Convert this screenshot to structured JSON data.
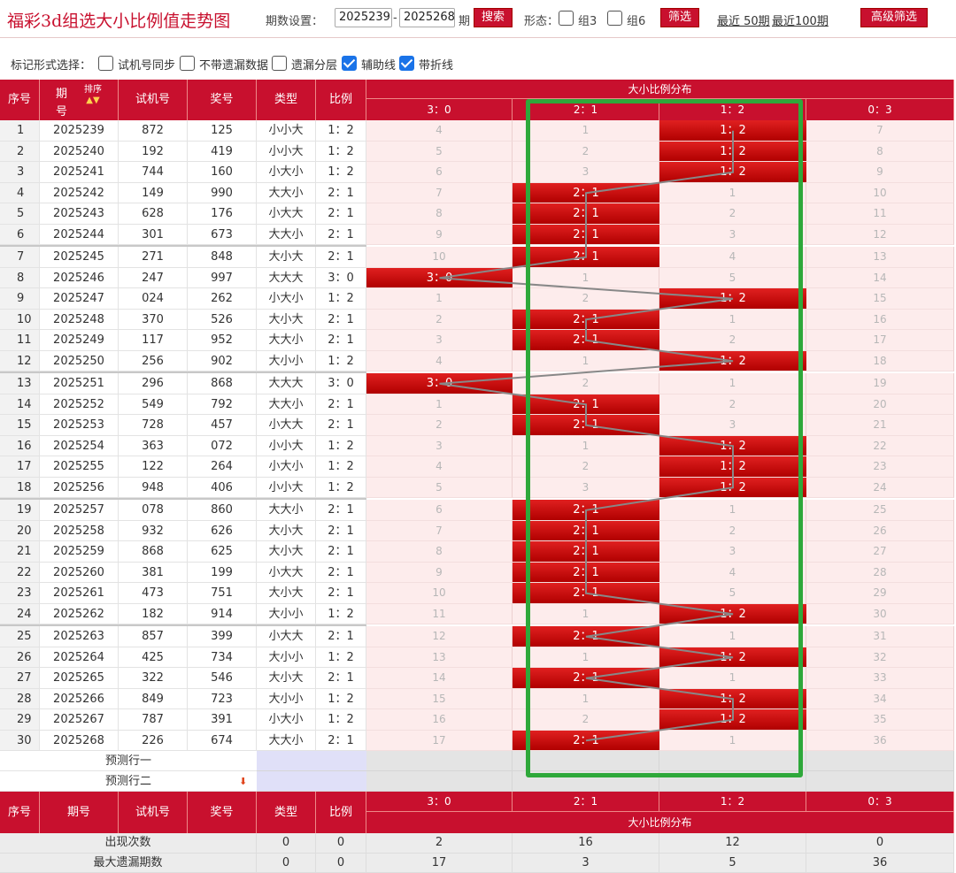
{
  "header": {
    "title": "福彩3d组选大小比例值走势图",
    "period_setting_label": "期数设置：",
    "period_start": "2025239",
    "period_dash": "-",
    "period_end": "2025268",
    "period_unit": "期",
    "search_button": "搜索",
    "form_label": "形态：",
    "group3_label": "组3",
    "group6_label": "组6",
    "filter_button": "筛选",
    "recent50_link": "最近 50期",
    "recent100_link": "最近100期",
    "advanced_button": "高级筛选"
  },
  "mark_options": {
    "label": "标记形式选择：",
    "items": [
      {
        "label": "试机号同步",
        "checked": false
      },
      {
        "label": "不带遗漏数据",
        "checked": false
      },
      {
        "label": "遗漏分层",
        "checked": false
      },
      {
        "label": "辅助线",
        "checked": true
      },
      {
        "label": "带折线",
        "checked": true
      }
    ]
  },
  "table": {
    "headers": {
      "seq": "序号",
      "issue_top": "期",
      "issue_bottom": "号",
      "sort_label": "排序",
      "trial": "试机号",
      "prize": "奖号",
      "type": "类型",
      "ratio": "比例",
      "distribution": "大小比例分布",
      "issue": "期号"
    },
    "ratio_columns": [
      "3：0",
      "2：1",
      "1：2",
      "0：3"
    ],
    "rows": [
      {
        "seq": "1",
        "issue": "2025239",
        "trial": "872",
        "prize": "125",
        "type": "小小大",
        "ratio": "1：2",
        "dist": [
          "4",
          "1",
          "1：2",
          "7"
        ],
        "hit": 2
      },
      {
        "seq": "2",
        "issue": "2025240",
        "trial": "192",
        "prize": "419",
        "type": "小小大",
        "ratio": "1：2",
        "dist": [
          "5",
          "2",
          "1：2",
          "8"
        ],
        "hit": 2
      },
      {
        "seq": "3",
        "issue": "2025241",
        "trial": "744",
        "prize": "160",
        "type": "小大小",
        "ratio": "1：2",
        "dist": [
          "6",
          "3",
          "1：2",
          "9"
        ],
        "hit": 2
      },
      {
        "seq": "4",
        "issue": "2025242",
        "trial": "149",
        "prize": "990",
        "type": "大大小",
        "ratio": "2：1",
        "dist": [
          "7",
          "2：1",
          "1",
          "10"
        ],
        "hit": 1
      },
      {
        "seq": "5",
        "issue": "2025243",
        "trial": "628",
        "prize": "176",
        "type": "小大大",
        "ratio": "2：1",
        "dist": [
          "8",
          "2：1",
          "2",
          "11"
        ],
        "hit": 1
      },
      {
        "seq": "6",
        "issue": "2025244",
        "trial": "301",
        "prize": "673",
        "type": "大大小",
        "ratio": "2：1",
        "dist": [
          "9",
          "2：1",
          "3",
          "12"
        ],
        "hit": 1
      },
      {
        "seq": "7",
        "issue": "2025245",
        "trial": "271",
        "prize": "848",
        "type": "大小大",
        "ratio": "2：1",
        "dist": [
          "10",
          "2：1",
          "4",
          "13"
        ],
        "hit": 1
      },
      {
        "seq": "8",
        "issue": "2025246",
        "trial": "247",
        "prize": "997",
        "type": "大大大",
        "ratio": "3：0",
        "dist": [
          "3：0",
          "1",
          "5",
          "14"
        ],
        "hit": 0
      },
      {
        "seq": "9",
        "issue": "2025247",
        "trial": "024",
        "prize": "262",
        "type": "小大小",
        "ratio": "1：2",
        "dist": [
          "1",
          "2",
          "1：2",
          "15"
        ],
        "hit": 2
      },
      {
        "seq": "10",
        "issue": "2025248",
        "trial": "370",
        "prize": "526",
        "type": "大小大",
        "ratio": "2：1",
        "dist": [
          "2",
          "2：1",
          "1",
          "16"
        ],
        "hit": 1
      },
      {
        "seq": "11",
        "issue": "2025249",
        "trial": "117",
        "prize": "952",
        "type": "大大小",
        "ratio": "2：1",
        "dist": [
          "3",
          "2：1",
          "2",
          "17"
        ],
        "hit": 1
      },
      {
        "seq": "12",
        "issue": "2025250",
        "trial": "256",
        "prize": "902",
        "type": "大小小",
        "ratio": "1：2",
        "dist": [
          "4",
          "1",
          "1：2",
          "18"
        ],
        "hit": 2
      },
      {
        "seq": "13",
        "issue": "2025251",
        "trial": "296",
        "prize": "868",
        "type": "大大大",
        "ratio": "3：0",
        "dist": [
          "3：0",
          "2",
          "1",
          "19"
        ],
        "hit": 0
      },
      {
        "seq": "14",
        "issue": "2025252",
        "trial": "549",
        "prize": "792",
        "type": "大大小",
        "ratio": "2：1",
        "dist": [
          "1",
          "2：1",
          "2",
          "20"
        ],
        "hit": 1
      },
      {
        "seq": "15",
        "issue": "2025253",
        "trial": "728",
        "prize": "457",
        "type": "小大大",
        "ratio": "2：1",
        "dist": [
          "2",
          "2：1",
          "3",
          "21"
        ],
        "hit": 1
      },
      {
        "seq": "16",
        "issue": "2025254",
        "trial": "363",
        "prize": "072",
        "type": "小小大",
        "ratio": "1：2",
        "dist": [
          "3",
          "1",
          "1：2",
          "22"
        ],
        "hit": 2
      },
      {
        "seq": "17",
        "issue": "2025255",
        "trial": "122",
        "prize": "264",
        "type": "小大小",
        "ratio": "1：2",
        "dist": [
          "4",
          "2",
          "1：2",
          "23"
        ],
        "hit": 2
      },
      {
        "seq": "18",
        "issue": "2025256",
        "trial": "948",
        "prize": "406",
        "type": "小小大",
        "ratio": "1：2",
        "dist": [
          "5",
          "3",
          "1：2",
          "24"
        ],
        "hit": 2
      },
      {
        "seq": "19",
        "issue": "2025257",
        "trial": "078",
        "prize": "860",
        "type": "大大小",
        "ratio": "2：1",
        "dist": [
          "6",
          "2：1",
          "1",
          "25"
        ],
        "hit": 1
      },
      {
        "seq": "20",
        "issue": "2025258",
        "trial": "932",
        "prize": "626",
        "type": "大小大",
        "ratio": "2：1",
        "dist": [
          "7",
          "2：1",
          "2",
          "26"
        ],
        "hit": 1
      },
      {
        "seq": "21",
        "issue": "2025259",
        "trial": "868",
        "prize": "625",
        "type": "大小大",
        "ratio": "2：1",
        "dist": [
          "8",
          "2：1",
          "3",
          "27"
        ],
        "hit": 1
      },
      {
        "seq": "22",
        "issue": "2025260",
        "trial": "381",
        "prize": "199",
        "type": "小大大",
        "ratio": "2：1",
        "dist": [
          "9",
          "2：1",
          "4",
          "28"
        ],
        "hit": 1
      },
      {
        "seq": "23",
        "issue": "2025261",
        "trial": "473",
        "prize": "751",
        "type": "大小大",
        "ratio": "2：1",
        "dist": [
          "10",
          "2：1",
          "5",
          "29"
        ],
        "hit": 1
      },
      {
        "seq": "24",
        "issue": "2025262",
        "trial": "182",
        "prize": "914",
        "type": "大小小",
        "ratio": "1：2",
        "dist": [
          "11",
          "1",
          "1：2",
          "30"
        ],
        "hit": 2
      },
      {
        "seq": "25",
        "issue": "2025263",
        "trial": "857",
        "prize": "399",
        "type": "小大大",
        "ratio": "2：1",
        "dist": [
          "12",
          "2：1",
          "1",
          "31"
        ],
        "hit": 1
      },
      {
        "seq": "26",
        "issue": "2025264",
        "trial": "425",
        "prize": "734",
        "type": "大小小",
        "ratio": "1：2",
        "dist": [
          "13",
          "1",
          "1：2",
          "32"
        ],
        "hit": 2
      },
      {
        "seq": "27",
        "issue": "2025265",
        "trial": "322",
        "prize": "546",
        "type": "大小大",
        "ratio": "2：1",
        "dist": [
          "14",
          "2：1",
          "1",
          "33"
        ],
        "hit": 1
      },
      {
        "seq": "28",
        "issue": "2025266",
        "trial": "849",
        "prize": "723",
        "type": "大小小",
        "ratio": "1：2",
        "dist": [
          "15",
          "1",
          "1：2",
          "34"
        ],
        "hit": 2
      },
      {
        "seq": "29",
        "issue": "2025267",
        "trial": "787",
        "prize": "391",
        "type": "小大小",
        "ratio": "1：2",
        "dist": [
          "16",
          "2",
          "1：2",
          "35"
        ],
        "hit": 2
      },
      {
        "seq": "30",
        "issue": "2025268",
        "trial": "226",
        "prize": "674",
        "type": "大大小",
        "ratio": "2：1",
        "dist": [
          "17",
          "2：1",
          "1",
          "36"
        ],
        "hit": 1
      }
    ],
    "prediction": [
      "预测行一",
      "预测行二"
    ],
    "stats": [
      {
        "label": "出现次数",
        "type": "0",
        "ratio": "0",
        "values": [
          "2",
          "16",
          "12",
          "0"
        ]
      },
      {
        "label": "最大遗漏期数",
        "type": "0",
        "ratio": "0",
        "values": [
          "17",
          "3",
          "5",
          "36"
        ]
      }
    ]
  },
  "colors": {
    "accent": "#c8102e",
    "highlight_box": "#2ea83a",
    "dist_bg": "#fdecec",
    "trend_line": "#888888"
  }
}
